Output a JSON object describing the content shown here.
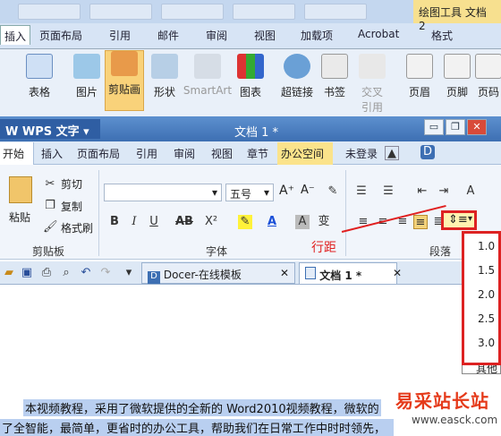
{
  "word_window": {
    "context_tool": "绘图工具",
    "context_doc": "文档 2",
    "tabs": [
      "插入",
      "页面布局",
      "引用",
      "邮件",
      "审阅",
      "视图",
      "加载项",
      "Acrobat",
      "格式"
    ],
    "ribbon_buttons": [
      "表格",
      "图片",
      "剪贴画",
      "形状",
      "SmartArt",
      "图表",
      "超链接",
      "书签",
      "交叉\n引用",
      "页眉",
      "页脚",
      "页码"
    ]
  },
  "wps": {
    "app_name": "WPS 文字",
    "doc_title": "文档 1 *",
    "tabs": [
      "开始",
      "插入",
      "页面布局",
      "引用",
      "审阅",
      "视图",
      "章节",
      "办公空间",
      "未登录"
    ],
    "clipboard": {
      "paste": "粘贴",
      "cut": "剪切",
      "copy": "复制",
      "format_painter": "格式刷",
      "group": "剪贴板"
    },
    "font": {
      "font_name_value": "",
      "font_size_value": "五号",
      "group": "字体",
      "grow": "A⁺",
      "shrink": "A⁻"
    },
    "paragraph_group": "段落",
    "doc_tabs": {
      "docer": "Docer-在线模板",
      "doc1": "文档 1 *"
    },
    "line_spacing_options": [
      "1.0",
      "1.5",
      "2.0",
      "2.5",
      "3.0",
      "其他"
    ]
  },
  "annotation": {
    "label": "行距"
  },
  "document": {
    "line1": "本视频教程，采用了微软提供的全新的 Word2010视频教程，微软的",
    "line2": "了全智能，最简单，更省时的办公工具，帮助我们在日常工作中时时领先，"
  },
  "watermark": {
    "text": "易采站长站",
    "url": "www.easck.com"
  },
  "colors": {
    "accent": "#3d6fb3",
    "highlight": "#d22222",
    "office_tab": "#fbe38b"
  }
}
